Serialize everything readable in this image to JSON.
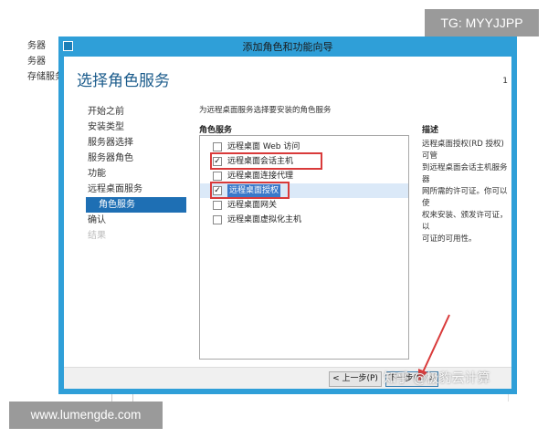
{
  "background": {
    "left_items": [
      "务器",
      "务器",
      "存储服务"
    ]
  },
  "watermarks": {
    "top": "TG: MYYJJPP",
    "bottom": "www.lumengde.com",
    "zhihu": "知乎 @极豹云计算"
  },
  "window": {
    "title": "添加角色和功能向导",
    "heading": "选择角色服务",
    "destination_marker": "1",
    "nav": [
      {
        "label": "开始之前",
        "state": "normal"
      },
      {
        "label": "安装类型",
        "state": "normal"
      },
      {
        "label": "服务器选择",
        "state": "normal"
      },
      {
        "label": "服务器角色",
        "state": "normal"
      },
      {
        "label": "功能",
        "state": "normal"
      },
      {
        "label": "远程桌面服务",
        "state": "normal"
      },
      {
        "label": "角色服务",
        "state": "active"
      },
      {
        "label": "确认",
        "state": "normal"
      },
      {
        "label": "结果",
        "state": "disabled"
      }
    ],
    "instruction": "为远程桌面服务选择要安装的角色服务",
    "roles_header": "角色服务",
    "roles": [
      {
        "label": "远程桌面 Web 访问",
        "checked": false
      },
      {
        "label": "远程桌面会话主机",
        "checked": true
      },
      {
        "label": "远程桌面连接代理",
        "checked": false
      },
      {
        "label": "远程桌面授权",
        "checked": true
      },
      {
        "label": "远程桌面网关",
        "checked": false
      },
      {
        "label": "远程桌面虚拟化主机",
        "checked": false
      }
    ],
    "description_title": "描述",
    "description_lines": [
      "远程桌面授权(RD 授权)可管",
      "到远程桌面会话主机服务器",
      "网所需的许可证。你可以使",
      "权来安装、颁发许可证，以",
      "可证的可用性。"
    ],
    "buttons": {
      "prev": "< 上一步(P)",
      "next": "下一步(N) >"
    }
  },
  "colors": {
    "title_bar": "#2f9fd8",
    "heading": "#1c5c8c",
    "nav_active": "#1e6fb4",
    "highlight_box": "#d93a3a",
    "arrow": "#d93a3a"
  }
}
